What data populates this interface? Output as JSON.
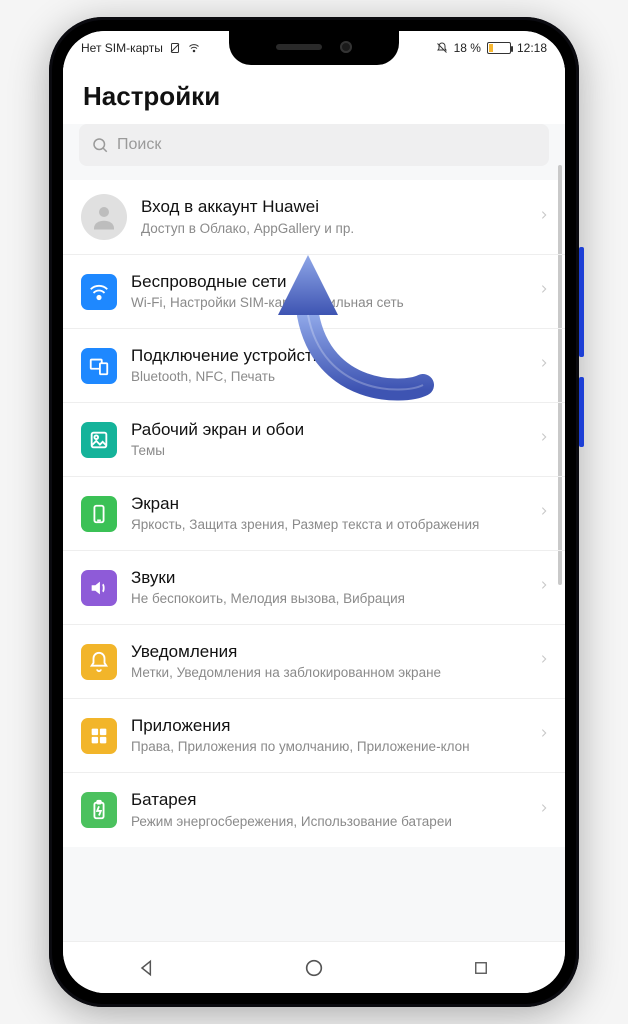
{
  "status": {
    "sim_text": "Нет SIM-карты",
    "battery_text": "18 %",
    "time": "12:18"
  },
  "header": {
    "title": "Настройки"
  },
  "search": {
    "placeholder": "Поиск"
  },
  "account": {
    "title": "Вход в аккаунт Huawei",
    "sub": "Доступ в Облако, AppGallery и пр."
  },
  "items": [
    {
      "title": "Беспроводные сети",
      "sub": "Wi-Fi, Настройки SIM-карт, Мобильная сеть"
    },
    {
      "title": "Подключение устройства",
      "sub": "Bluetooth, NFC, Печать"
    },
    {
      "title": "Рабочий экран и обои",
      "sub": "Темы"
    },
    {
      "title": "Экран",
      "sub": "Яркость, Защита зрения, Размер текста и отображения"
    },
    {
      "title": "Звуки",
      "sub": "Не беспокоить, Мелодия вызова, Вибрация"
    },
    {
      "title": "Уведомления",
      "sub": "Метки, Уведомления на заблокированном экране"
    },
    {
      "title": "Приложения",
      "sub": "Права, Приложения по умолчанию, Приложение-клон"
    },
    {
      "title": "Батарея",
      "sub": "Режим энергосбережения, Использование батареи"
    }
  ]
}
